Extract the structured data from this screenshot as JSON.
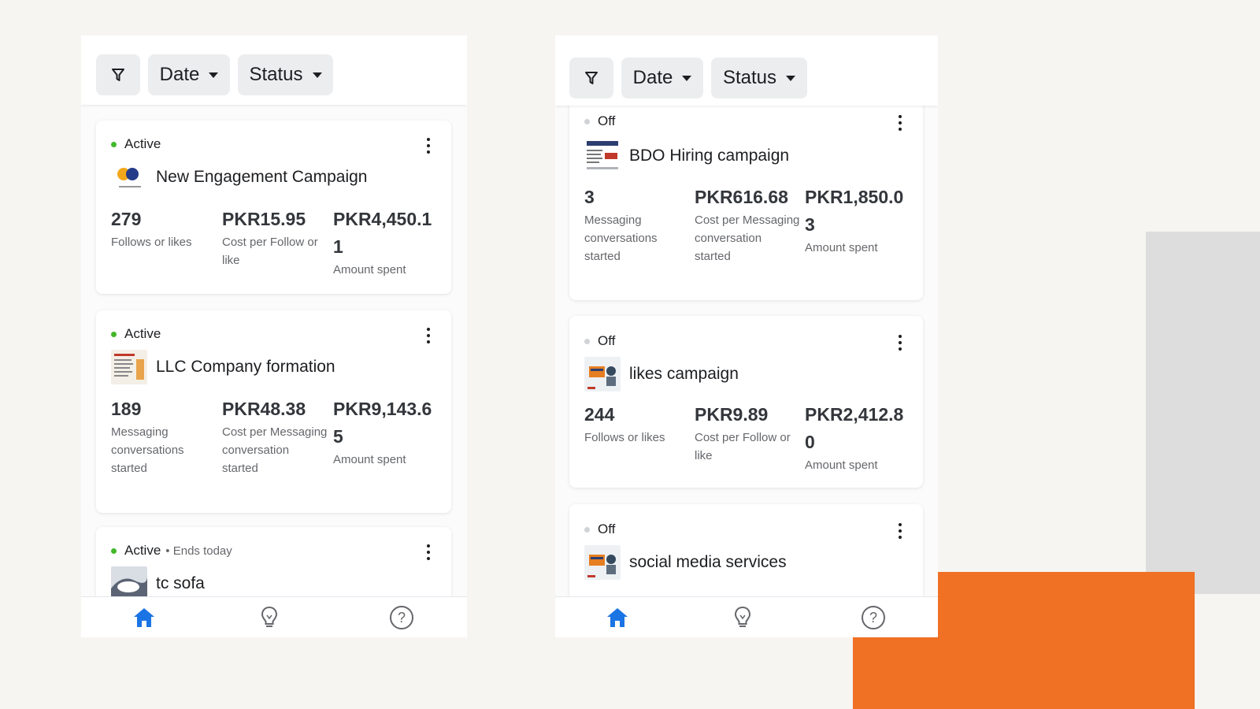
{
  "filters": {
    "date_label": "Date",
    "status_label": "Status"
  },
  "left_panel": {
    "campaigns": [
      {
        "status": "Active",
        "name": "New Engagement Campaign",
        "results_value": "279",
        "results_label": "Follows or likes",
        "cost_value": "PKR15.95",
        "cost_label": "Cost per Follow or like",
        "spent_value": "PKR4,450.11",
        "spent_label": "Amount spent"
      },
      {
        "status": "Active",
        "name": "LLC Company formation",
        "results_value": "189",
        "results_label": "Messaging conversations started",
        "cost_value": "PKR48.38",
        "cost_label": "Cost per Messaging conversation started",
        "spent_value": "PKR9,143.65",
        "spent_label": "Amount spent"
      },
      {
        "status": "Active",
        "status_extra": "• Ends today",
        "name": "tc sofa"
      }
    ]
  },
  "right_panel": {
    "campaigns": [
      {
        "status": "Off",
        "name": "BDO Hiring campaign",
        "results_value": "3",
        "results_label": "Messaging conversations started",
        "cost_value": "PKR616.68",
        "cost_label": "Cost per Messaging conversation started",
        "spent_value": "PKR1,850.03",
        "spent_label": "Amount spent"
      },
      {
        "status": "Off",
        "name": "likes campaign",
        "results_value": "244",
        "results_label": "Follows or likes",
        "cost_value": "PKR9.89",
        "cost_label": "Cost per Follow or like",
        "spent_value": "PKR2,412.80",
        "spent_label": "Amount spent"
      },
      {
        "status": "Off",
        "name": "social media services"
      }
    ]
  },
  "icons": {
    "filter": "filter-icon",
    "dropdown": "caret-down-icon",
    "more": "more-vertical-icon",
    "home": "home-icon",
    "ideas": "lightbulb-icon",
    "help": "help-icon"
  },
  "colors": {
    "active_dot": "#42b72a",
    "off_dot": "#d0d2d6",
    "nav_active": "#1b74e4",
    "accent_orange": "#f07024",
    "accent_gray": "#dddddd"
  },
  "nav": {
    "help_glyph": "?"
  }
}
